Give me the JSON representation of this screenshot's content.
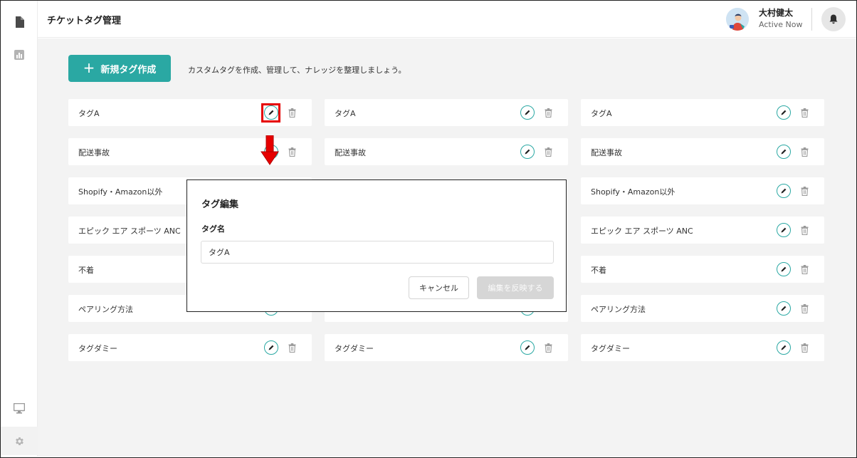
{
  "header": {
    "title": "チケットタグ管理",
    "user_name": "大村健太",
    "user_status": "Active Now"
  },
  "toolbar": {
    "new_tag_label": "新規タグ作成",
    "hint": "カスタムタグを作成、管理して、ナレッジを整理しましょう。"
  },
  "tags": {
    "col1": [
      "タグA",
      "配送事故",
      "Shopify・Amazon以外",
      "エピック エア スポーツ ANC",
      "不着",
      "ペアリング方法",
      "タグダミー"
    ],
    "col2": [
      "タグA",
      "配送事故",
      "タグダミー"
    ],
    "col3": [
      "タグA",
      "配送事故",
      "Shopify・Amazon以外",
      "エピック エア スポーツ ANC",
      "不着",
      "ペアリング方法",
      "タグダミー"
    ]
  },
  "modal": {
    "title": "タグ編集",
    "field_label": "タグ名",
    "field_value": "タグA",
    "cancel_label": "キャンセル",
    "apply_label": "編集を反映する"
  },
  "colors": {
    "accent": "#2aa8a3",
    "highlight": "#e60000",
    "background": "#f3f3f3"
  },
  "icons": {
    "sidebar": [
      "document-icon",
      "bar-chart-icon",
      "monitor-icon",
      "gear-icon"
    ],
    "header": [
      "avatar",
      "bell-icon"
    ],
    "tag": [
      "pencil-icon",
      "trash-icon"
    ]
  }
}
